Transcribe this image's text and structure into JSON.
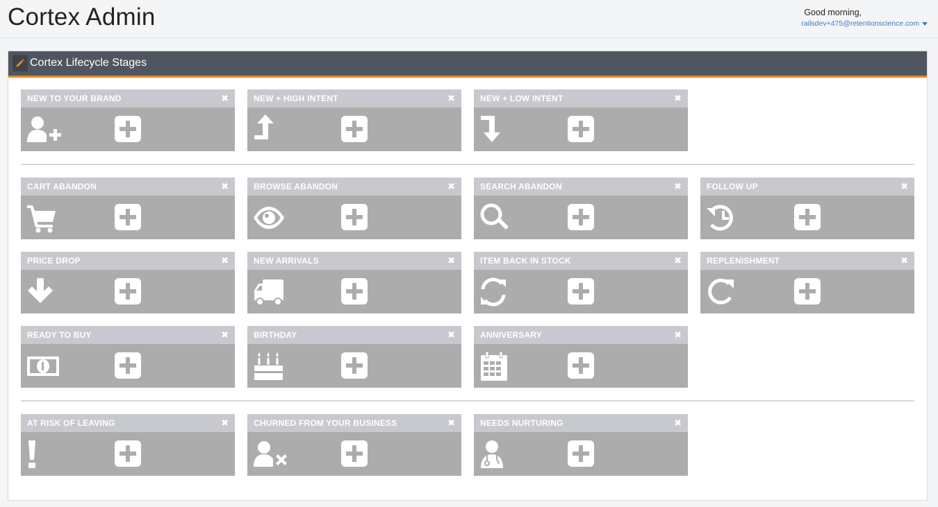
{
  "app": {
    "title": "Cortex Admin",
    "greeting": "Good morning,",
    "user_email": "railsdev+475@retentionscience.com"
  },
  "panel": {
    "title": "Cortex Lifecycle Stages",
    "accent_color": "#f08a24",
    "header_color": "#50565f"
  },
  "cards": [
    {
      "label": "NEW TO YOUR BRAND",
      "icon": "user-plus-icon"
    },
    {
      "label": "NEW + HIGH INTENT",
      "icon": "arrow-up-turn-icon"
    },
    {
      "label": "NEW + LOW INTENT",
      "icon": "arrow-down-turn-icon"
    },
    {
      "label": "CART ABANDON",
      "icon": "cart-icon"
    },
    {
      "label": "BROWSE ABANDON",
      "icon": "eye-icon"
    },
    {
      "label": "SEARCH ABANDON",
      "icon": "search-icon"
    },
    {
      "label": "FOLLOW UP",
      "icon": "history-icon"
    },
    {
      "label": "PRICE DROP",
      "icon": "arrow-down-icon"
    },
    {
      "label": "NEW ARRIVALS",
      "icon": "truck-icon"
    },
    {
      "label": "ITEM BACK IN STOCK",
      "icon": "refresh-icon"
    },
    {
      "label": "REPLENISHMENT",
      "icon": "redo-icon"
    },
    {
      "label": "READY TO BUY",
      "icon": "money-icon"
    },
    {
      "label": "BIRTHDAY",
      "icon": "birthday-cake-icon"
    },
    {
      "label": "ANNIVERSARY",
      "icon": "calendar-icon"
    },
    {
      "label": "AT RISK OF LEAVING",
      "icon": "exclamation-icon"
    },
    {
      "label": "CHURNED FROM YOUR BUSINESS",
      "icon": "user-times-icon"
    },
    {
      "label": "NEEDS NURTURING",
      "icon": "user-md-icon"
    }
  ],
  "close_glyph": "✖"
}
